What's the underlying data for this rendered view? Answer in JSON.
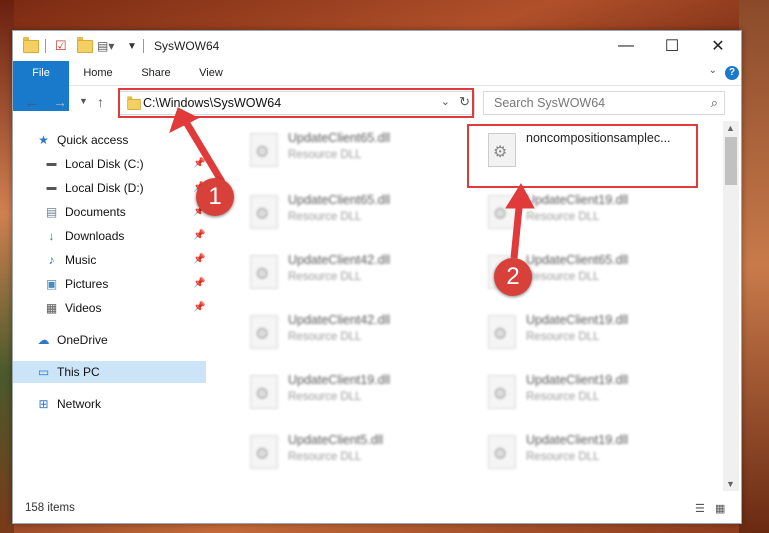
{
  "window": {
    "title": "SysWOW64",
    "minimize": "—",
    "maximize": "☐",
    "close": "✕"
  },
  "ribbon": {
    "tabs": [
      {
        "label": "File"
      },
      {
        "label": "Home"
      },
      {
        "label": "Share"
      },
      {
        "label": "View"
      }
    ],
    "help": "?"
  },
  "address": {
    "path": "C:\\Windows\\SysWOW64"
  },
  "search": {
    "placeholder": "Search SysWOW64"
  },
  "sidebar": {
    "items": [
      {
        "label": "Quick access",
        "icon": "star-icon"
      },
      {
        "label": "Local Disk (C:)",
        "icon": "drive-icon"
      },
      {
        "label": "Local Disk (D:)",
        "icon": "drive-icon"
      },
      {
        "label": "Documents",
        "icon": "documents-icon"
      },
      {
        "label": "Downloads",
        "icon": "download-icon"
      },
      {
        "label": "Music",
        "icon": "music-icon"
      },
      {
        "label": "Pictures",
        "icon": "pictures-icon"
      },
      {
        "label": "Videos",
        "icon": "videos-icon"
      },
      {
        "label": "OneDrive",
        "icon": "cloud-icon"
      },
      {
        "label": "This PC",
        "icon": "computer-icon"
      },
      {
        "label": "Network",
        "icon": "network-icon"
      }
    ]
  },
  "files": {
    "col1": [
      {
        "name": "UpdateClient65.dll",
        "type": "Resource DLL"
      },
      {
        "name": "UpdateClient65.dll",
        "type": "Resource DLL"
      },
      {
        "name": "UpdateClient42.dll",
        "type": "Resource DLL"
      },
      {
        "name": "UpdateClient42.dll",
        "type": "Resource DLL"
      },
      {
        "name": "UpdateClient19.dll",
        "type": "Resource DLL"
      },
      {
        "name": "UpdateClient5.dll",
        "type": "Resource DLL"
      }
    ],
    "col2": [
      {
        "name": "noncompositionsamplec...",
        "type": ""
      },
      {
        "name": "UpdateClient19.dll",
        "type": "Resource DLL"
      },
      {
        "name": "UpdateClient65.dll",
        "type": "Resource DLL"
      },
      {
        "name": "UpdateClient19.dll",
        "type": "Resource DLL"
      },
      {
        "name": "UpdateClient19.dll",
        "type": "Resource DLL"
      },
      {
        "name": "UpdateClient19.dll",
        "type": "Resource DLL"
      }
    ]
  },
  "status": {
    "items_count": "158 items"
  },
  "annotations": {
    "step1": "1",
    "step2": "2",
    "color": "#e03a3a"
  }
}
